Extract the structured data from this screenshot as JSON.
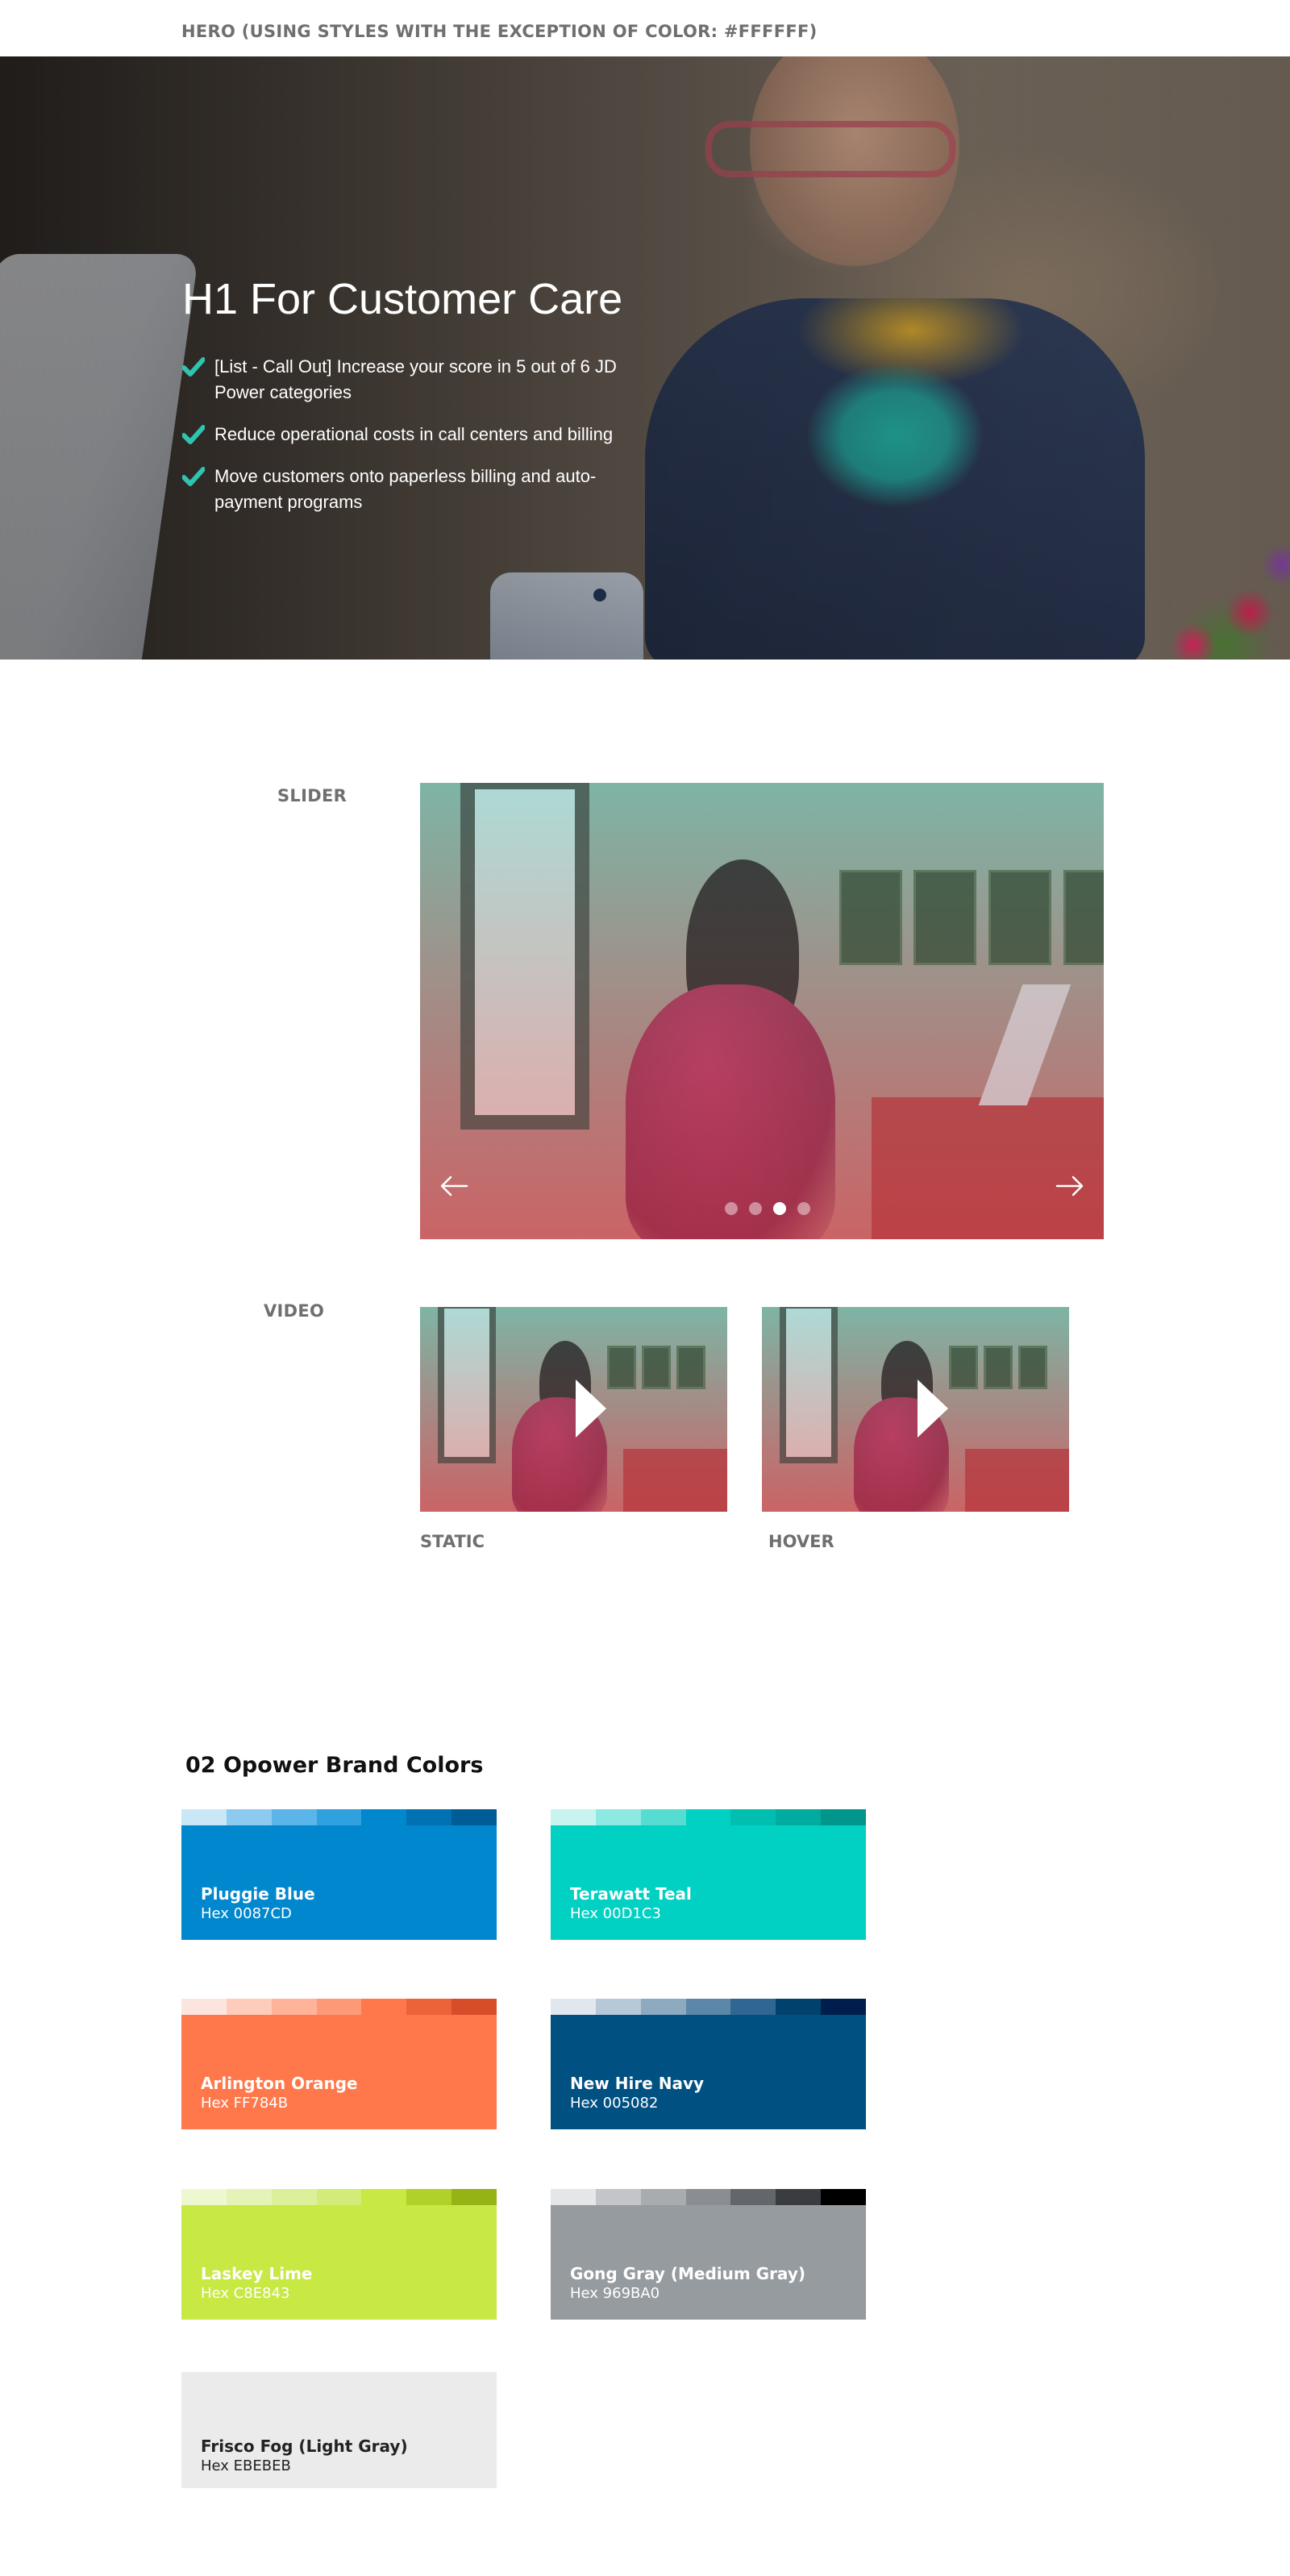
{
  "hero": {
    "section_label": "HERO (USING STYLES WITH THE EXCEPTION OF COLOR: #FFFFFF)",
    "title": "H1 For Customer Care",
    "bullets": [
      "[List - Call Out] Increase your score in 5 out of 6 JD Power categories",
      "Reduce operational costs in call centers and billing",
      "Move customers onto paperless billing and auto-payment programs"
    ],
    "check_color": "#2ec4b0"
  },
  "slider": {
    "section_label": "SLIDER",
    "dots_count": 4,
    "active_dot": 3
  },
  "video": {
    "section_label": "VIDEO",
    "static_caption": "STATIC",
    "hover_caption": "HOVER"
  },
  "brand_colors": {
    "title": "02 Opower Brand Colors",
    "swatches": [
      {
        "name": "Pluggie Blue",
        "hex": "Hex  0087CD",
        "color": "#0087CD",
        "tints": [
          "#c9e7f7",
          "#8ccaf0",
          "#5bb5e8",
          "#2ea1de",
          "#0087CD",
          "#0072b4",
          "#005c97"
        ]
      },
      {
        "name": "Terawatt Teal",
        "hex": "Hex  00D1C3",
        "color": "#00D1C3",
        "tints": [
          "#c8f4f0",
          "#8de9e1",
          "#55ddd2",
          "#00D1C3",
          "#00bfb1",
          "#00ab9f",
          "#00968b"
        ]
      },
      {
        "name": "Arlington Orange",
        "hex": "Hex  FF784B",
        "color": "#FF784B",
        "tints": [
          "#fbe5de",
          "#fdccbb",
          "#feb39a",
          "#fe9978",
          "#FF784B",
          "#ec6239",
          "#d84d29"
        ]
      },
      {
        "name": "New Hire Navy",
        "hex": "Hex  005082",
        "color": "#005082",
        "tints": [
          "#e1e7ee",
          "#b7c9d8",
          "#8daac1",
          "#5c87a8",
          "#2f6792",
          "#00426d",
          "#001e4d"
        ]
      },
      {
        "name": "Laskey Lime",
        "hex": "Hex  C8E843",
        "color": "#C8E843",
        "tints": [
          "#eef8d0",
          "#e4f4b6",
          "#daf09a",
          "#d2ec7a",
          "#C8E843",
          "#b0d12a",
          "#95b314"
        ]
      },
      {
        "name": "Gong Gray (Medium Gray)",
        "hex": "Hex  969BA0",
        "color": "#969BA0",
        "tints": [
          "#e5e6e7",
          "#c3c5c8",
          "#a9acaf",
          "#8a8d91",
          "#63666a",
          "#3a3c3f",
          "#000000"
        ]
      },
      {
        "name": "Frisco Fog (Light Gray)",
        "hex": "Hex  EBEBEB",
        "color": "#EBEBEB",
        "tints": []
      }
    ]
  }
}
